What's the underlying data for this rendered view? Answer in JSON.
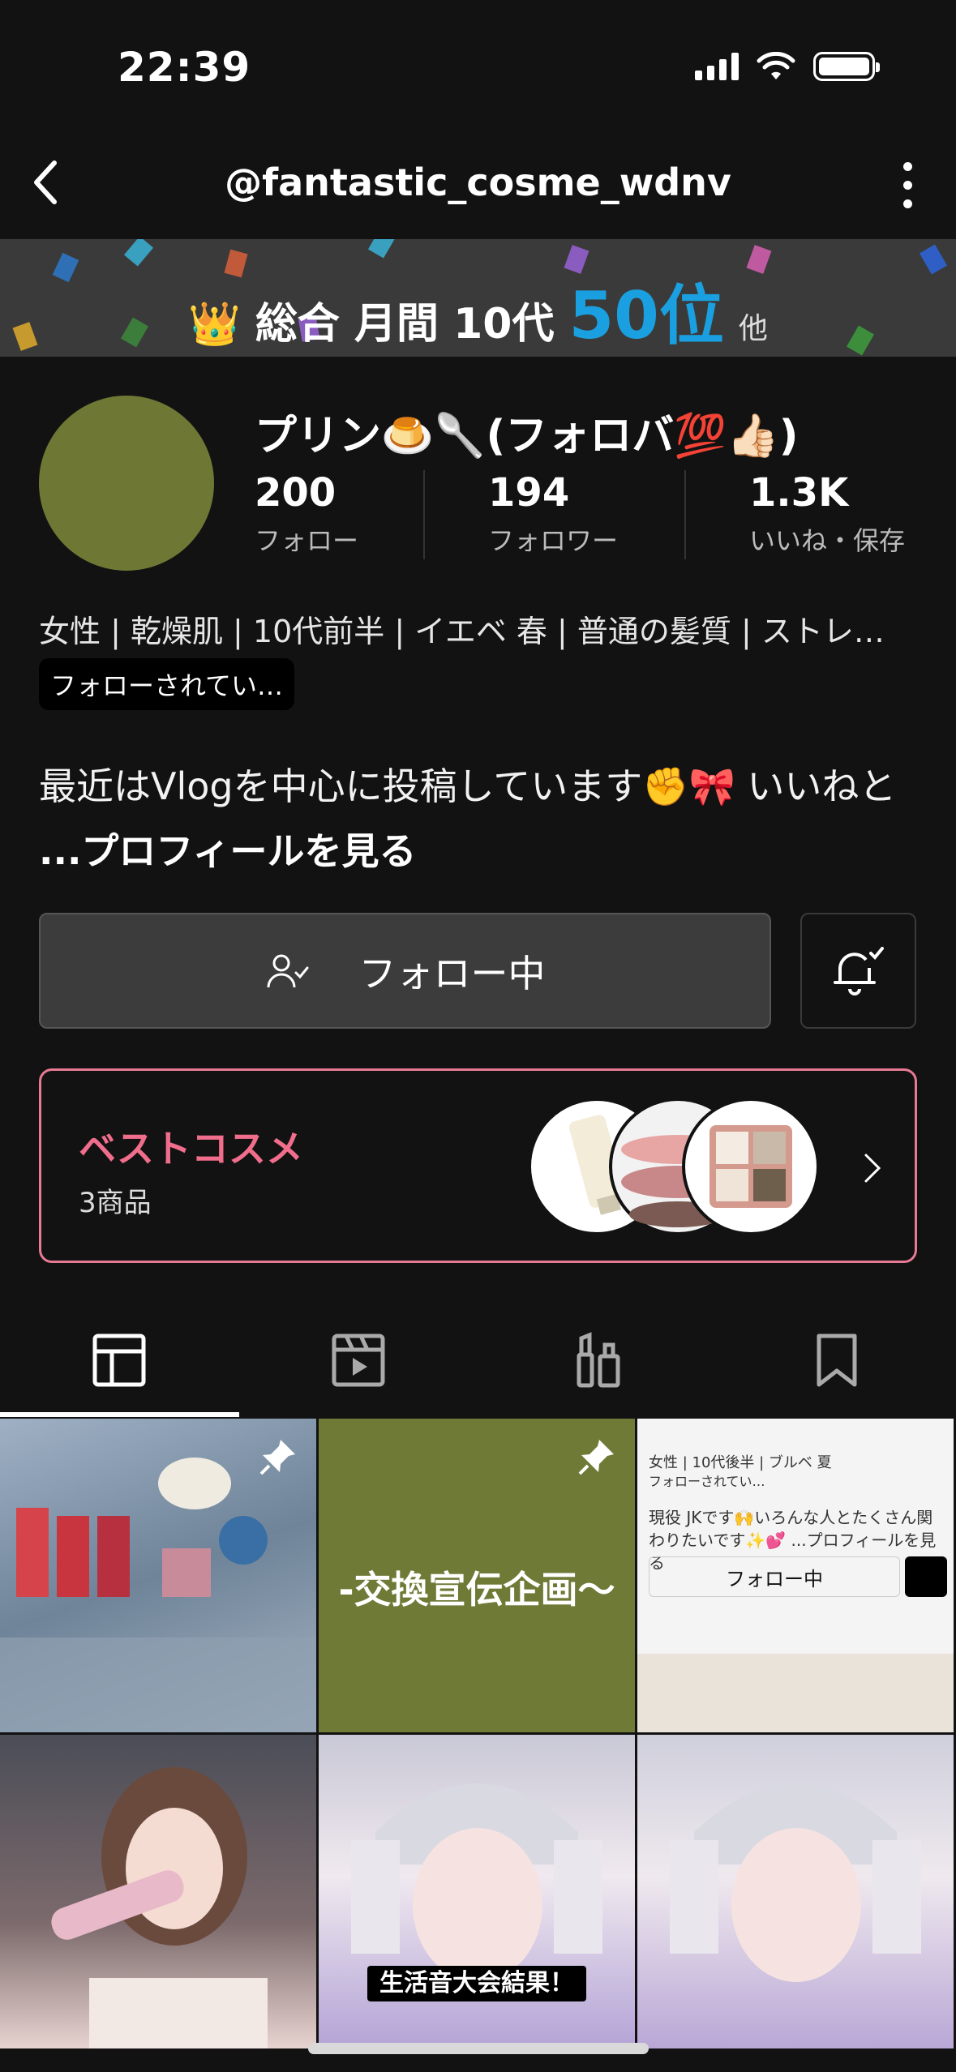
{
  "status_bar": {
    "time": "22:39"
  },
  "nav": {
    "title": "@fantastic_cosme_wdnv"
  },
  "rank_banner": {
    "crown": "👑",
    "label": "総合 月間 10代",
    "rank": "50位",
    "other": "他"
  },
  "profile": {
    "name": "プリン🍮🥄(フォロバ💯👍🏻)",
    "stats": [
      {
        "value": "200",
        "label": "フォロー"
      },
      {
        "value": "194",
        "label": "フォロワー"
      },
      {
        "value": "1.3K",
        "label": "いいね・保存"
      }
    ],
    "tags": "女性 | 乾燥肌 | 10代前半 | イエベ 春 | 普通の髪質 | ストレ…",
    "follow_status": "フォローされてい…",
    "bio": "最近はVlogを中心に投稿しています✊🎀 いいねと ",
    "bio_more": "...プロフィールを見る"
  },
  "actions": {
    "follow_label": "フォロー中"
  },
  "best_cosme": {
    "title": "ベストコスメ",
    "count": "3商品"
  },
  "tabs": [
    "posts",
    "videos",
    "cosmetics",
    "saved"
  ],
  "grid": {
    "caption_2": "-交換宣伝企画〜",
    "cell3_tags": "女性 | 10代後半 | ブルベ 夏",
    "cell3_follow": "フォローされてい…",
    "cell3_bio": "現役 JKです🙌いろんな人とたくさん関わりたいです✨💕 ...プロフィールを見る",
    "cell3_button": "フォロー中",
    "caption_5": "生活音大会結果！"
  }
}
